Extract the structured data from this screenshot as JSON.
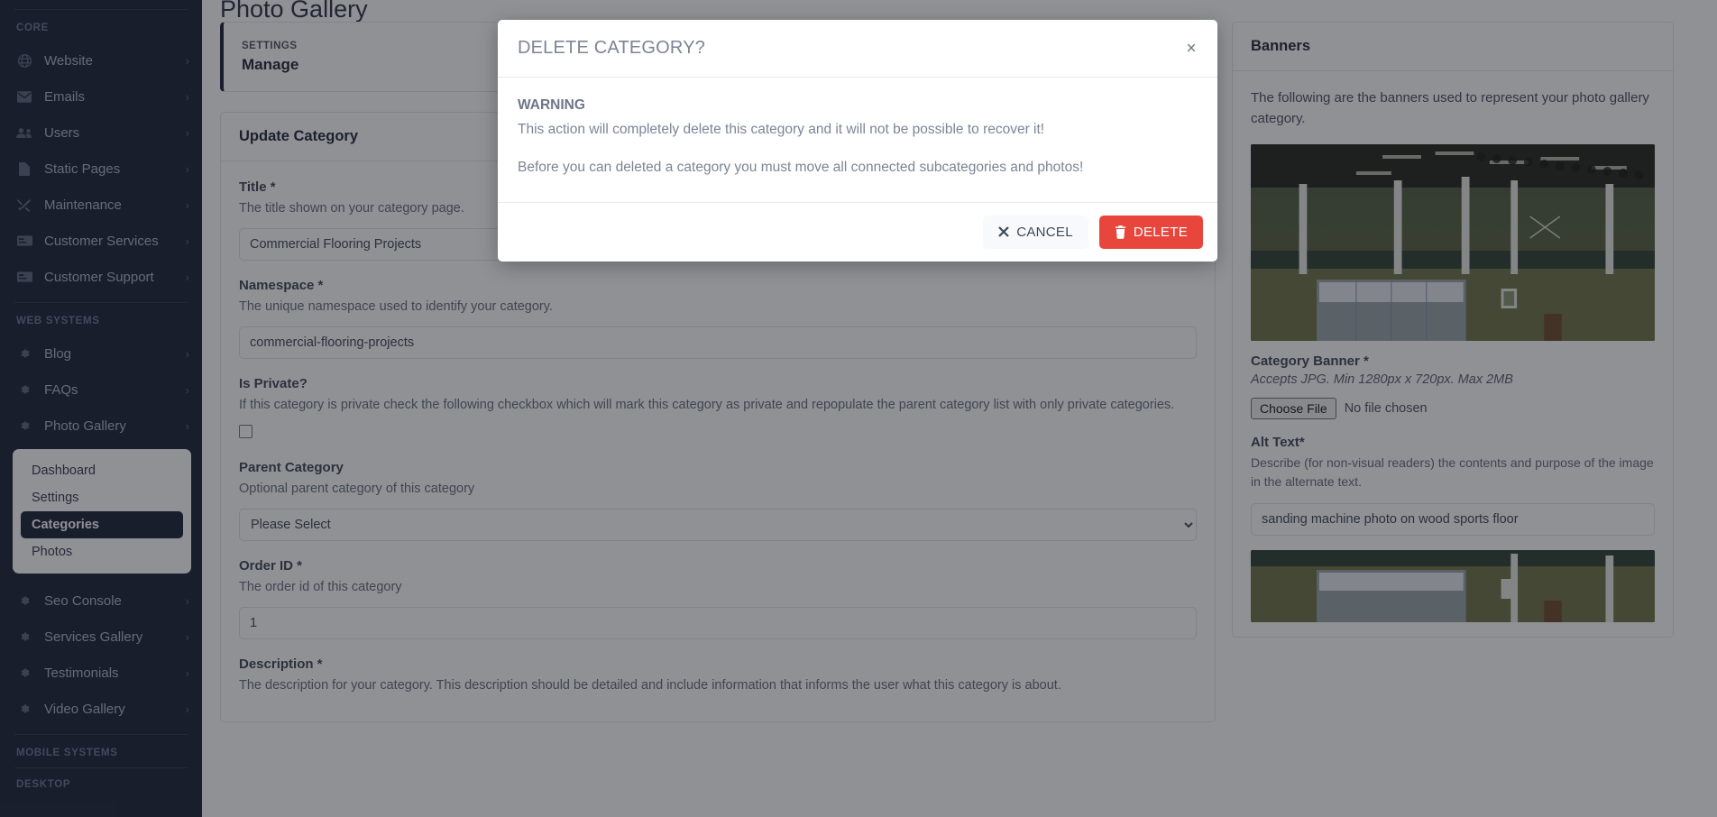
{
  "sidebar": {
    "sections": [
      {
        "label": "CORE",
        "items": [
          {
            "label": "Website",
            "icon": "globe-icon"
          },
          {
            "label": "Emails",
            "icon": "envelope-icon"
          },
          {
            "label": "Users",
            "icon": "users-icon"
          },
          {
            "label": "Static Pages",
            "icon": "document-icon"
          },
          {
            "label": "Maintenance",
            "icon": "tools-icon"
          },
          {
            "label": "Customer Services",
            "icon": "card-icon"
          },
          {
            "label": "Customer Support",
            "icon": "card-icon"
          }
        ]
      },
      {
        "label": "WEB SYSTEMS",
        "items": [
          {
            "label": "Blog",
            "icon": "gear-icon"
          },
          {
            "label": "FAQs",
            "icon": "gear-icon"
          },
          {
            "label": "Photo Gallery",
            "icon": "gear-icon"
          }
        ]
      }
    ],
    "submenu": {
      "items": [
        {
          "label": "Dashboard",
          "active": false
        },
        {
          "label": "Settings",
          "active": false
        },
        {
          "label": "Categories",
          "active": true
        },
        {
          "label": "Photos",
          "active": false
        }
      ]
    },
    "after_submenu_items": [
      {
        "label": "Seo Console",
        "icon": "gear-icon"
      },
      {
        "label": "Services Gallery",
        "icon": "gear-icon"
      },
      {
        "label": "Testimonials",
        "icon": "gear-icon"
      },
      {
        "label": "Video Gallery",
        "icon": "gear-icon"
      }
    ],
    "bottom_sections": [
      {
        "label": "MOBILE SYSTEMS"
      },
      {
        "label": "DESKTOP"
      }
    ],
    "chevron": "›"
  },
  "page": {
    "title": "Photo Gallery"
  },
  "settings_card": {
    "eyebrow": "SETTINGS",
    "title": "Manage",
    "icon": "globe-icon"
  },
  "form": {
    "card_title": "Update Category",
    "fields": [
      {
        "label": "Title *",
        "help": "The title shown on your category page.",
        "value": "Commercial Flooring Projects",
        "type": "text",
        "name": "title-input"
      },
      {
        "label": "Namespace *",
        "help": "The unique namespace used to identify your category.",
        "value": "commercial-flooring-projects",
        "type": "text",
        "name": "namespace-input"
      },
      {
        "label": "Is Private?",
        "help": "If this category is private check the following checkbox which will mark this category as private and repopulate the parent category list with only private categories.",
        "value": "",
        "type": "checkbox",
        "name": "is-private-checkbox"
      },
      {
        "label": "Parent Category",
        "help": "Optional parent category of this category",
        "value": "Please Select",
        "type": "select",
        "name": "parent-category-select"
      },
      {
        "label": "Order ID *",
        "help": "The order id of this category",
        "value": "1",
        "type": "text",
        "name": "order-id-input"
      },
      {
        "label": "Description *",
        "help": "The description for your category. This description should be detailed and include information that informs the user what this category is about.",
        "value": "",
        "type": "text",
        "name": "description-input"
      }
    ]
  },
  "banners": {
    "card_title": "Banners",
    "intro": "The following are the banners used to represent your photo gallery category.",
    "category_banner_label": "Category Banner *",
    "category_banner_hint": "Accepts JPG. Min 1280px x 720px. Max 2MB",
    "file_button": "Choose File",
    "file_status": "No file chosen",
    "alt_text_label": "Alt Text*",
    "alt_text_help": "Describe (for non-visual readers) the contents and purpose of the image in the alternate text.",
    "alt_text_value": "sanding machine photo on wood sports floor"
  },
  "modal": {
    "title": "DELETE CATEGORY?",
    "close_icon": "×",
    "warning_heading": "WARNING",
    "line1": "This action will completely delete this category and it will not be possible to recover it!",
    "line2": "Before you can deleted a category you must move all connected subcategories and photos!",
    "cancel_label": "CANCEL",
    "delete_label": "DELETE"
  },
  "colors": {
    "sidebar_bg": "#1c2438",
    "danger": "#e8463c",
    "accent_dark": "#1c2438"
  }
}
